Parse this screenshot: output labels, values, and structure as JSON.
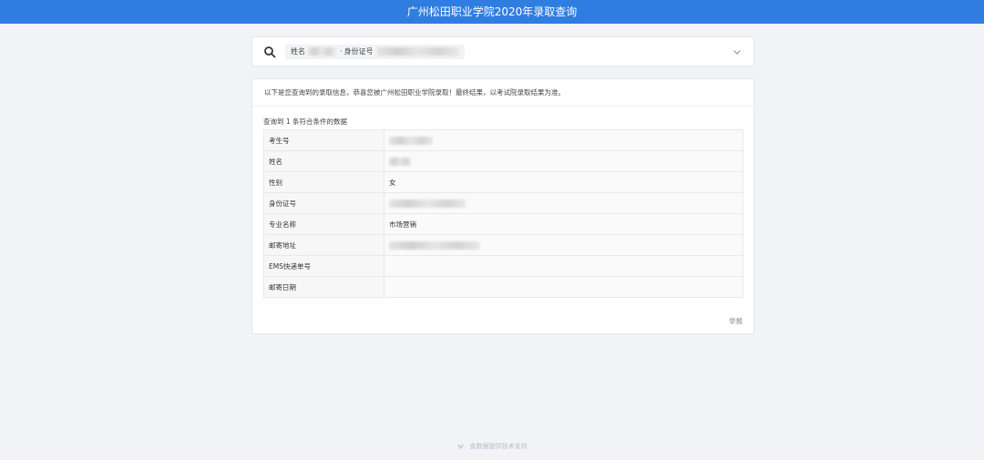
{
  "header": {
    "title": "广州松田职业学院2020年录取查询"
  },
  "search": {
    "name_label": "姓名",
    "separator": "·",
    "id_label": "身份证号"
  },
  "result": {
    "notice": "以下是您查询到的录取信息，恭喜您被广州松田职业学院录取！最终结果，以考试院录取结果为准。",
    "count_text": "查询到 1 条符合条件的数据",
    "rows": [
      {
        "label": "考生号",
        "value": ""
      },
      {
        "label": "姓名",
        "value": ""
      },
      {
        "label": "性别",
        "value": "女"
      },
      {
        "label": "身份证号",
        "value": ""
      },
      {
        "label": "专业名称",
        "value": "市场营销"
      },
      {
        "label": "邮寄地址",
        "value": ""
      },
      {
        "label": "EMS快递单号",
        "value": ""
      },
      {
        "label": "邮寄日期",
        "value": ""
      }
    ],
    "report_label": "举报"
  },
  "footer": {
    "text": "金数据提供技术支持"
  },
  "colors": {
    "brand": "#2f7de1",
    "background": "#f1f3f7"
  },
  "icons": {
    "search": "search-icon",
    "expand": "chevron-down-icon",
    "footer": "logo-icon"
  }
}
